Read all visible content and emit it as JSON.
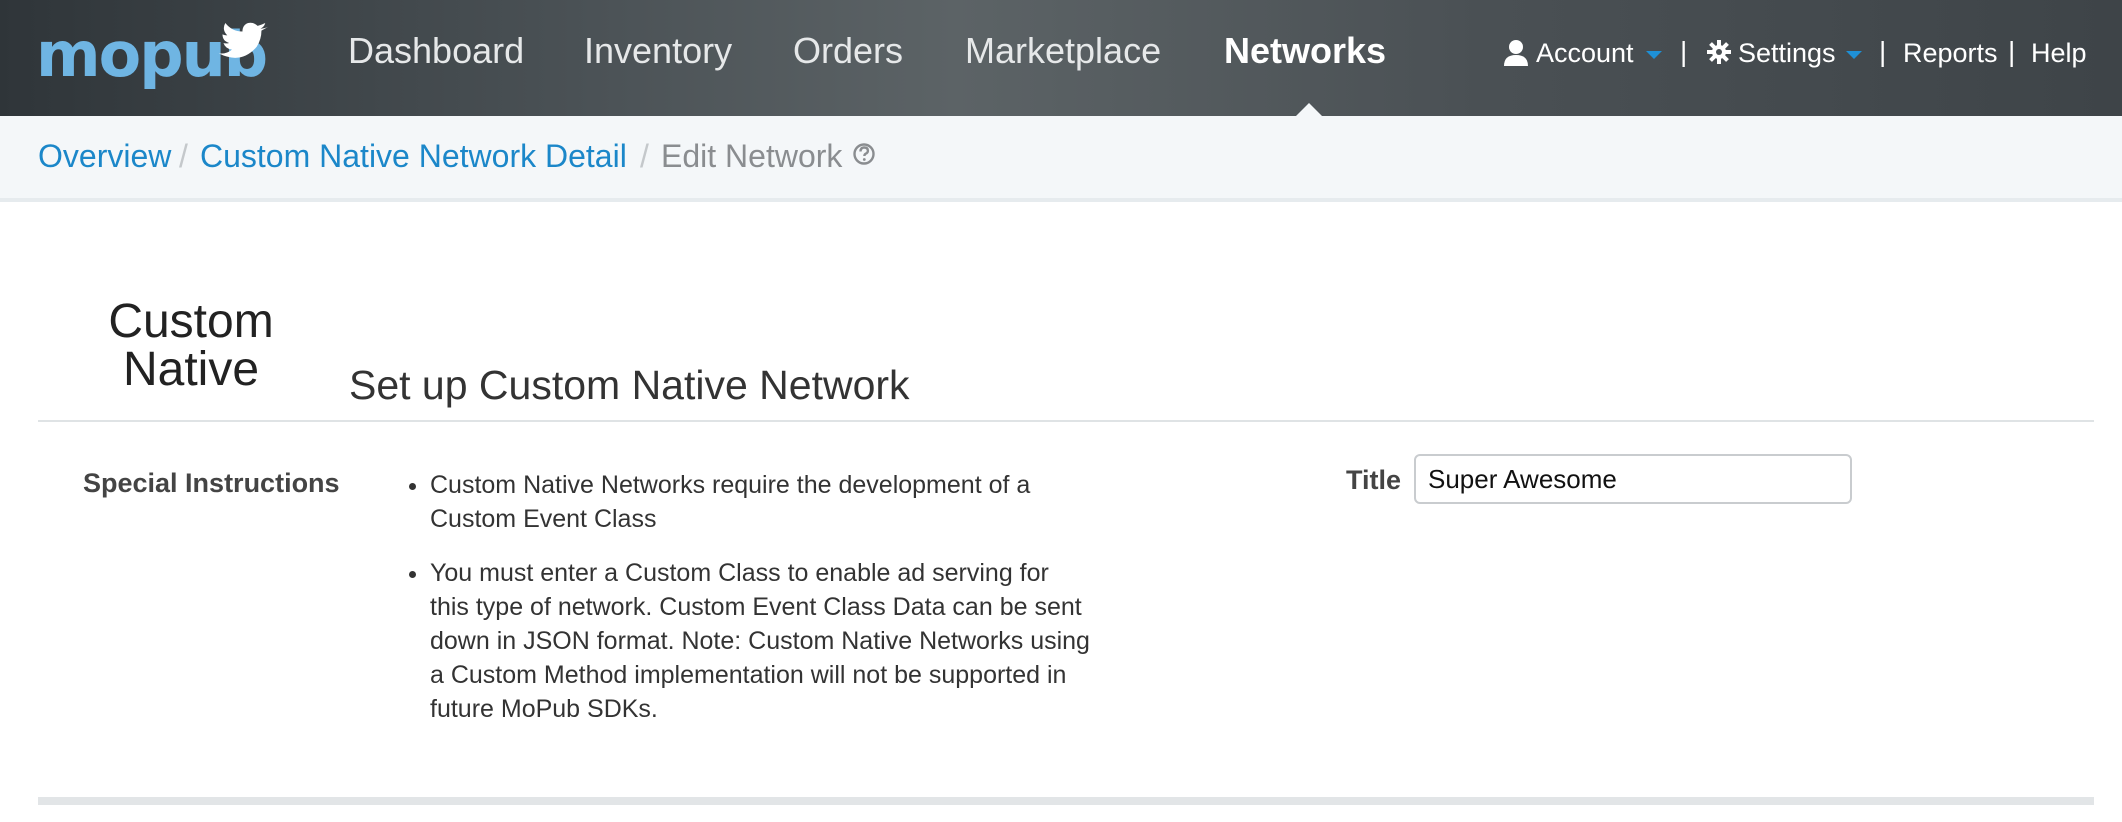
{
  "nav": {
    "logo_text": "mopub",
    "items": [
      {
        "label": "Dashboard"
      },
      {
        "label": "Inventory"
      },
      {
        "label": "Orders"
      },
      {
        "label": "Marketplace"
      },
      {
        "label": "Networks",
        "active": true
      }
    ],
    "utility": {
      "account": "Account",
      "settings": "Settings",
      "reports": "Reports",
      "help": "Help",
      "separator": "|"
    }
  },
  "breadcrumb": {
    "items": [
      "Overview",
      "Custom Native Network Detail",
      "Edit Network"
    ],
    "separator": "/"
  },
  "network": {
    "logo_line1": "Custom",
    "logo_line2": "Native",
    "heading": "Set up Custom Native Network"
  },
  "instructions": {
    "label": "Special Instructions",
    "items": [
      "Custom Native Networks require the development of a Custom Event Class",
      "You must enter a Custom Class to enable ad serving for this type of network. Custom Event Class Data can be sent down in JSON format. Note: Custom Native Networks using a Custom Method implementation will not be supported in future MoPub SDKs."
    ]
  },
  "form": {
    "title_label": "Title",
    "title_value": "Super Awesome"
  },
  "colors": {
    "link": "#1b87c9",
    "logo_blue": "#6fb5e3",
    "caret_blue": "#1e90d6"
  }
}
